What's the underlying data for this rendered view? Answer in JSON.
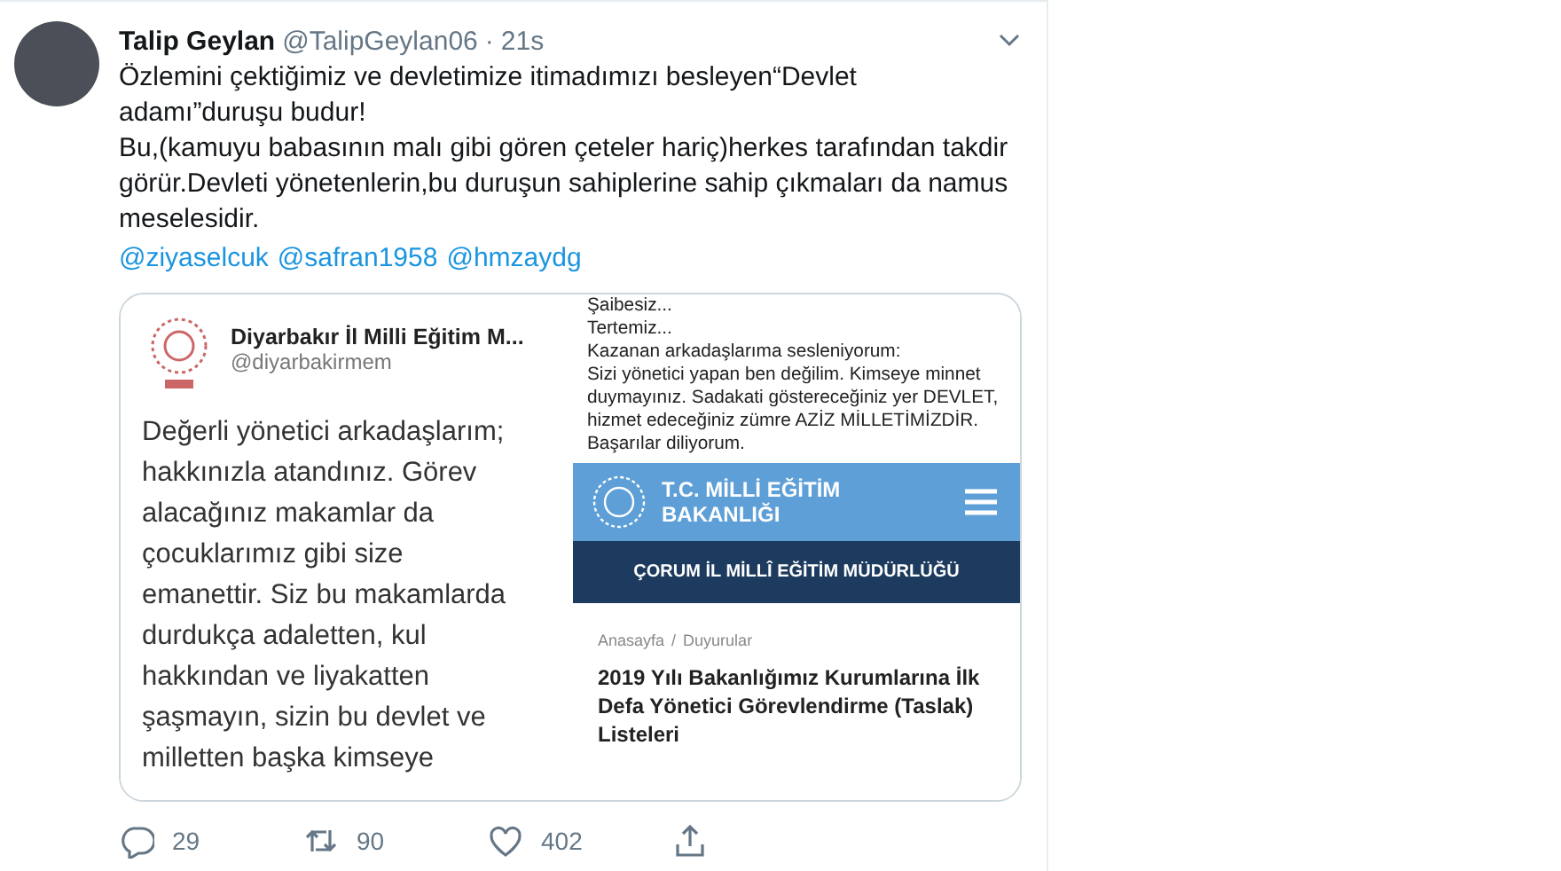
{
  "tweet": {
    "author": {
      "name": "Talip Geylan",
      "handle": "@TalipGeylan06",
      "separator": "·",
      "time": "21s"
    },
    "text_lines": [
      "Özlemini çektiğimiz ve devletimize itimadımızı besleyen“Devlet adamı”duruşu budur!",
      "Bu,(kamuyu babasının malı gibi gören çeteler hariç)herkes tarafından takdir görür.Devleti yönetenlerin,bu duruşun sahiplerine sahip çıkmaları da namus meselesidir."
    ],
    "mentions": [
      "@ziyaselcuk",
      "@safran1958",
      "@hmzaydg"
    ],
    "media": {
      "left": {
        "name": "Diyarbakır İl Milli Eğitim M...",
        "handle": "@diyarbakirmem",
        "body_lines": [
          "Değerli yönetici arkadaşlarım;",
          "hakkınızla atandınız. Görev",
          "alacağınız makamlar da",
          "çocuklarımız gibi size",
          "emanettir. Siz bu makamlarda",
          "durdukça adaletten, kul",
          "hakkından ve liyakatten",
          "şaşmayın, sizin bu devlet ve",
          "milletten başka kimseye"
        ]
      },
      "right": {
        "lines": [
          "Şaibesiz...",
          "Tertemiz...",
          "Kazanan arkadaşlarıma sesleniyorum:",
          "Sizi yönetici yapan ben değilim. Kimseye minnet duymayınız. Sadakati göstereceğiniz yer DEVLET, hizmet edeceğiniz zümre AZİZ MİLLETİMİZDİR.",
          "Başarılar diliyorum."
        ],
        "site_title": "T.C. MİLLİ EĞİTİM BAKANLIĞI",
        "subtitle": "ÇORUM İL MİLLÎ EĞİTİM MÜDÜRLÜĞÜ",
        "breadcrumb": [
          "Anasayfa",
          "/",
          "Duyurular"
        ],
        "headline": "2019 Yılı Bakanlığımız Kurumlarına İlk Defa Yönetici Görevlendirme (Taslak) Listeleri"
      }
    },
    "actions": [
      {
        "kind": "reply",
        "count": "29"
      },
      {
        "kind": "retweet",
        "count": "90"
      },
      {
        "kind": "like",
        "count": "402"
      },
      {
        "kind": "share"
      }
    ]
  }
}
